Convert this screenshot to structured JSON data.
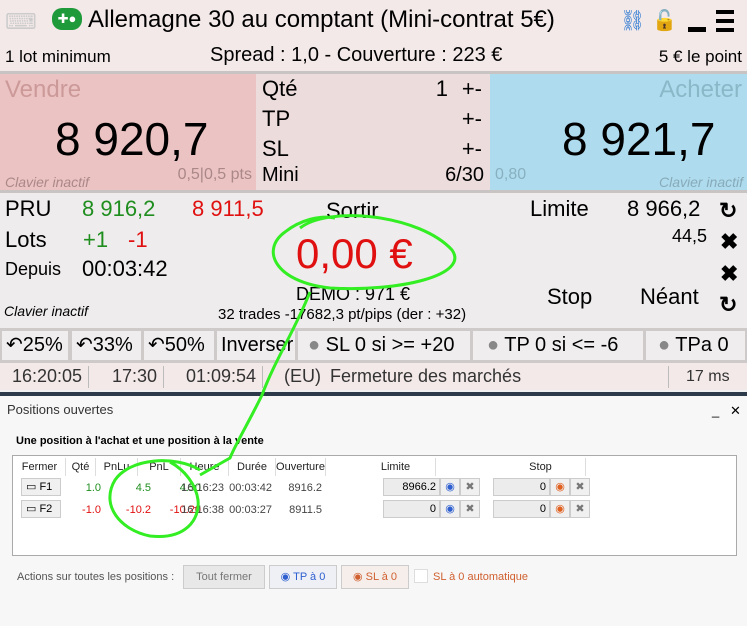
{
  "header": {
    "title": "Allemagne 30 au comptant (Mini-contrat 5€)",
    "min_lot": "1 lot minimum",
    "spread": "Spread : 1,0 - Couverture : 223 €",
    "point_value": "5 € le point"
  },
  "sell": {
    "label": "Vendre",
    "price": "8 920,7",
    "keyboard": "Clavier inactif",
    "spread_pts": "0,5|0,5 pts"
  },
  "order": {
    "qty_label": "Qté",
    "qty": "1",
    "tp_label": "TP",
    "sl_label": "SL",
    "mini_label": "Mini",
    "mini": "6/30",
    "plusminus": "+-"
  },
  "buy": {
    "label": "Acheter",
    "price": "8 921,7",
    "keyboard": "Clavier inactif",
    "value": "0,80"
  },
  "position": {
    "pru_label": "PRU",
    "pru_buy": "8 916,2",
    "pru_sell": "8 911,5",
    "lots_label": "Lots",
    "lots_buy": "+1",
    "lots_sell": "-1",
    "since_label": "Depuis",
    "since": "00:03:42",
    "keyboard": "Clavier inactif",
    "exit_label": "Sortir",
    "pnl": "0,00 €",
    "account": "DEMO : 971 €",
    "trades": "32 trades -17682,3 pt/pips (der : +32)",
    "limit_label": "Limite",
    "limit": "8 966,2",
    "limit_dist": "44,5",
    "stop_label": "Stop",
    "stop": "Néant"
  },
  "quick": {
    "b25": "25%",
    "b33": "33%",
    "b50": "50%",
    "reverse": "Inverser",
    "sl0": "SL 0 si >= +20",
    "tp0": "TP 0 si <= -6",
    "tpa0": "TPa 0"
  },
  "status": {
    "time": "16:20:05",
    "close": "17:30",
    "countdown": "01:09:54",
    "region": "(EU)",
    "message": "Fermeture des marchés",
    "latency": "17 ms"
  },
  "dialog": {
    "title": "Positions ouvertes",
    "subtitle": "Une position à l'achat et une position à la vente",
    "columns": [
      "Fermer",
      "Qté",
      "PnLu",
      "PnL",
      "Heure",
      "Durée",
      "Ouverture",
      "Limite",
      "Stop"
    ],
    "rows": [
      {
        "close": "F1",
        "qty": "1.0",
        "pnlu": "4.5",
        "pnl": "4.50",
        "time": "16:16:23",
        "duration": "00:03:42",
        "open": "8916.2",
        "limit": "8966.2",
        "stop": "0"
      },
      {
        "close": "F2",
        "qty": "-1.0",
        "pnlu": "-10.2",
        "pnl": "-10.20",
        "time": "16:16:38",
        "duration": "00:03:27",
        "open": "8911.5",
        "limit": "0",
        "stop": "0"
      }
    ],
    "actions_label": "Actions sur toutes les positions :",
    "close_all": "Tout fermer",
    "tp_zero": "TP à 0",
    "sl_zero": "SL à 0",
    "auto_sl": "SL à 0 automatique"
  },
  "colors": {
    "sell_bg": "#ecc3c3",
    "buy_bg": "#aedcee",
    "gain": "#1f8e1f",
    "loss": "#e01010",
    "annotation": "#33ee22"
  }
}
